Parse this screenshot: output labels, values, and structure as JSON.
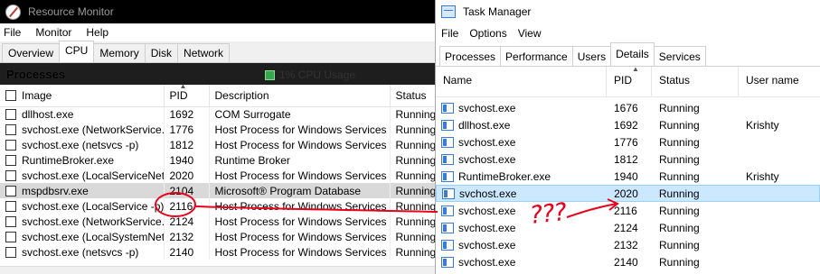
{
  "resource_monitor": {
    "title": "Resource Monitor",
    "menu": [
      "File",
      "Monitor",
      "Help"
    ],
    "tabs": [
      "Overview",
      "CPU",
      "Memory",
      "Disk",
      "Network"
    ],
    "active_tab": "CPU",
    "section_title": "Processes",
    "cpu_usage": "1% CPU Usage",
    "columns": [
      "Image",
      "PID",
      "Description",
      "Status"
    ],
    "rows": [
      {
        "image": "dllhost.exe",
        "pid": "1692",
        "description": "COM Surrogate",
        "status": "Running"
      },
      {
        "image": "svchost.exe (NetworkService...",
        "pid": "1776",
        "description": "Host Process for Windows Services",
        "status": "Running"
      },
      {
        "image": "svchost.exe (netsvcs -p)",
        "pid": "1812",
        "description": "Host Process for Windows Services",
        "status": "Running"
      },
      {
        "image": "RuntimeBroker.exe",
        "pid": "1940",
        "description": "Runtime Broker",
        "status": "Running"
      },
      {
        "image": "svchost.exe (LocalServiceNet...",
        "pid": "2020",
        "description": "Host Process for Windows Services",
        "status": "Running"
      },
      {
        "image": "mspdbsrv.exe",
        "pid": "2104",
        "description": "Microsoft® Program Database",
        "status": "Running"
      },
      {
        "image": "svchost.exe (LocalService -p)",
        "pid": "2116",
        "description": "Host Process for Windows Services",
        "status": "Running"
      },
      {
        "image": "svchost.exe (NetworkService...",
        "pid": "2124",
        "description": "Host Process for Windows Services",
        "status": "Running"
      },
      {
        "image": "svchost.exe (LocalSystemNet...",
        "pid": "2132",
        "description": "Host Process for Windows Services",
        "status": "Running"
      },
      {
        "image": "svchost.exe (netsvcs -p)",
        "pid": "2140",
        "description": "Host Process for Windows Services",
        "status": "Running"
      }
    ]
  },
  "task_manager": {
    "title": "Task Manager",
    "menu": [
      "File",
      "Options",
      "View"
    ],
    "tabs": [
      "Processes",
      "Performance",
      "Users",
      "Details",
      "Services"
    ],
    "active_tab": "Details",
    "columns": [
      "Name",
      "PID",
      "Status",
      "User name"
    ],
    "rows": [
      {
        "name": "svchost.exe",
        "pid": "1676",
        "status": "Running",
        "user": ""
      },
      {
        "name": "dllhost.exe",
        "pid": "1692",
        "status": "Running",
        "user": "Krishty"
      },
      {
        "name": "svchost.exe",
        "pid": "1776",
        "status": "Running",
        "user": ""
      },
      {
        "name": "svchost.exe",
        "pid": "1812",
        "status": "Running",
        "user": ""
      },
      {
        "name": "RuntimeBroker.exe",
        "pid": "1940",
        "status": "Running",
        "user": "Krishty"
      },
      {
        "name": "svchost.exe",
        "pid": "2020",
        "status": "Running",
        "user": ""
      },
      {
        "name": "svchost.exe",
        "pid": "2116",
        "status": "Running",
        "user": ""
      },
      {
        "name": "svchost.exe",
        "pid": "2124",
        "status": "Running",
        "user": ""
      },
      {
        "name": "svchost.exe",
        "pid": "2132",
        "status": "Running",
        "user": ""
      },
      {
        "name": "svchost.exe",
        "pid": "2140",
        "status": "Running",
        "user": ""
      }
    ]
  },
  "annotation": {
    "text": "???",
    "color": "#e8001c"
  }
}
